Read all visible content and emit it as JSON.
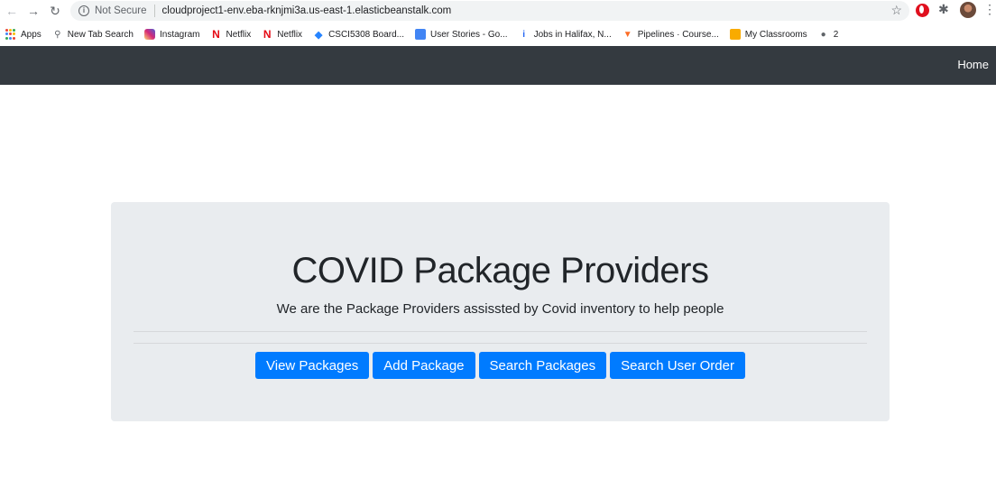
{
  "browser": {
    "url": "cloudproject1-env.eba-rknjmi3a.us-east-1.elasticbeanstalk.com",
    "security_label": "Not Secure",
    "icons": {
      "back": "arrow-left-icon",
      "forward": "arrow-right-icon",
      "reload": "reload-icon",
      "info": "info-icon",
      "bookmark_star": "star-icon",
      "extension_opera": "opera-icon",
      "extensions": "puzzle-icon",
      "profile": "avatar",
      "menu": "more-vert-icon"
    }
  },
  "bookmarks": [
    {
      "label": "Apps",
      "icon": "apps-grid-icon"
    },
    {
      "label": "New Tab Search",
      "icon": "search-icon"
    },
    {
      "label": "Instagram",
      "icon": "instagram-icon"
    },
    {
      "label": "Netflix",
      "icon": "netflix-icon"
    },
    {
      "label": "Netflix",
      "icon": "netflix-icon"
    },
    {
      "label": "CSCI5308 Board...",
      "icon": "jira-icon"
    },
    {
      "label": "User Stories - Go...",
      "icon": "google-docs-icon"
    },
    {
      "label": "Jobs in Halifax, N...",
      "icon": "indeed-icon"
    },
    {
      "label": "Pipelines · Course...",
      "icon": "gitlab-icon"
    },
    {
      "label": "My Classrooms",
      "icon": "classroom-icon"
    },
    {
      "label": "2",
      "icon": "globe-icon"
    }
  ],
  "navbar": {
    "home_label": "Home",
    "background": "#343a40"
  },
  "jumbotron": {
    "title": "COVID Package Providers",
    "lead": "We are the Package Providers assissted by Covid inventory to help people",
    "background": "#e9ecef"
  },
  "actions": [
    {
      "label": "View Packages"
    },
    {
      "label": "Add Package"
    },
    {
      "label": "Search Packages"
    },
    {
      "label": "Search User Order"
    }
  ],
  "colors": {
    "primary_button": "#007bff"
  }
}
